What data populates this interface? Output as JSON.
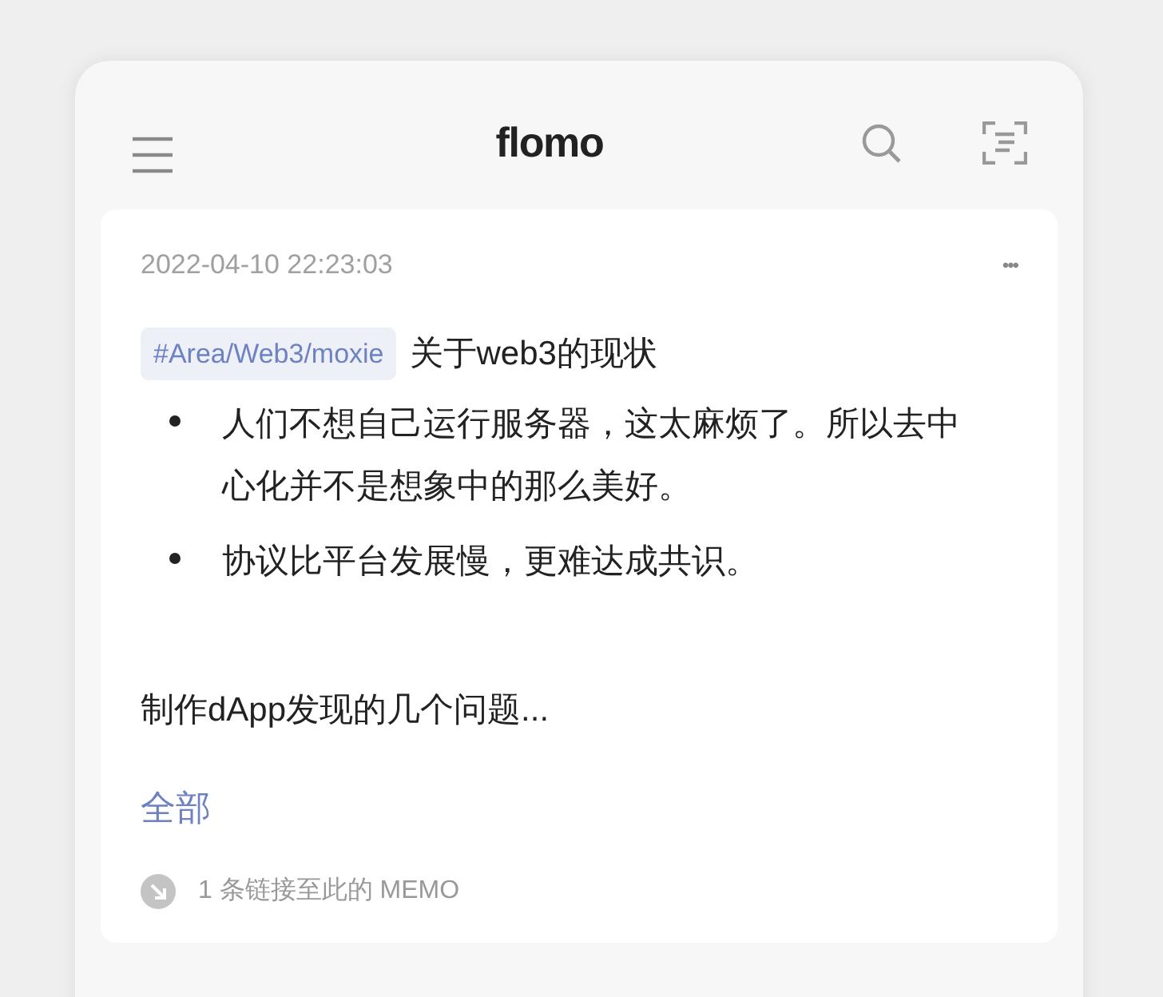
{
  "app_bar": {
    "title": "flomo"
  },
  "memo": {
    "timestamp": "2022-04-10 22:23:03",
    "menu": "•••",
    "tag": "#Area/Web3/moxie",
    "heading": "关于web3的现状",
    "bullets": [
      "人们不想自己运行服务器，这太麻烦了。所以去中心化并不是想象中的那么美好。",
      "协议比平台发展慢，更难达成共识。"
    ],
    "paragraph": "制作dApp发现的几个问题...",
    "expand_link": "全部",
    "backlinks": "1 条链接至此的 MEMO"
  }
}
